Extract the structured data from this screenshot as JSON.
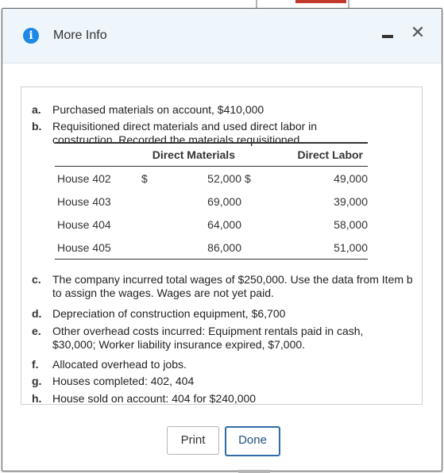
{
  "dialog": {
    "title": "More Info",
    "minimize_label": "–",
    "close_label": "✕"
  },
  "items": [
    {
      "letter": "a.",
      "text": "Purchased materials on account, $410,000"
    },
    {
      "letter": "b.",
      "text": "Requisitioned direct materials and used direct labor in construction. Recorded the materials requisitioned."
    },
    {
      "letter": "c.",
      "text": "The company incurred total wages of $250,000. Use the data from Item b to assign the wages. Wages are not yet paid."
    },
    {
      "letter": "d.",
      "text": "Depreciation of construction equipment, $6,700"
    },
    {
      "letter": "e.",
      "text": "Other overhead costs incurred: Equipment rentals paid in cash, $30,000; Worker liability insurance expired, $7,000."
    },
    {
      "letter": "f.",
      "text": "Allocated overhead to jobs."
    },
    {
      "letter": "g.",
      "text": "Houses completed: 402, 404"
    },
    {
      "letter": "h.",
      "text": "House sold on account: 404 for $240,000"
    }
  ],
  "table": {
    "headers": [
      "Direct Materials",
      "Direct Labor"
    ],
    "rows": [
      {
        "house": "House 402",
        "cur1": "$",
        "dm": "52,000",
        "cur2": "$",
        "dl": "49,000"
      },
      {
        "house": "House 403",
        "cur1": "",
        "dm": "69,000",
        "cur2": "",
        "dl": "39,000"
      },
      {
        "house": "House 404",
        "cur1": "",
        "dm": "64,000",
        "cur2": "",
        "dl": "58,000"
      },
      {
        "house": "House 405",
        "cur1": "",
        "dm": "86,000",
        "cur2": "",
        "dl": "51,000"
      }
    ]
  },
  "buttons": {
    "print": "Print",
    "done": "Done"
  },
  "colors": {
    "accent": "#1e88e5",
    "titlebar_bg": "#eef5fb",
    "done_border": "#2f6ba8"
  },
  "icons": {
    "info": "info-icon",
    "minimize": "minimize-icon",
    "close": "close-icon"
  }
}
